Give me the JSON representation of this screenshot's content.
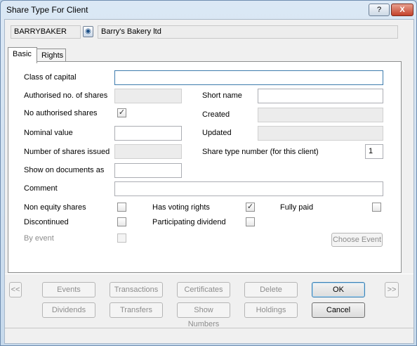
{
  "window": {
    "title": "Share Type For Client",
    "help_label": "?",
    "close_label": "X"
  },
  "header": {
    "client_code": "BARRYBAKER",
    "client_name": "Barry's Bakery ltd"
  },
  "tabs": [
    {
      "label": "Basic"
    },
    {
      "label": "Rights"
    }
  ],
  "form": {
    "class_of_capital_label": "Class of capital",
    "class_of_capital_value": "",
    "authorised_label": "Authorised no. of shares",
    "short_name_label": "Short name",
    "short_name_value": "",
    "no_authorised_label": "No authorised shares",
    "no_authorised_checked": true,
    "created_label": "Created",
    "nominal_label": "Nominal value",
    "nominal_value": "",
    "updated_label": "Updated",
    "issued_label": "Number of shares issued",
    "share_type_number_label": "Share type number (for this client)",
    "share_type_number_value": "1",
    "show_on_docs_label": "Show on documents as",
    "show_on_docs_value": "",
    "comment_label": "Comment",
    "comment_value": "",
    "non_equity_label": "Non equity shares",
    "voting_label": "Has voting rights",
    "voting_checked": true,
    "fully_paid_label": "Fully paid",
    "discontinued_label": "Discontinued",
    "participating_label": "Participating dividend",
    "by_event_label": "By event",
    "choose_event_label": "Choose Event"
  },
  "buttons": {
    "prev": "<<",
    "next": ">>",
    "events": "Events",
    "transactions": "Transactions",
    "certificates": "Certificates",
    "delete": "Delete",
    "ok": "OK",
    "dividends": "Dividends",
    "transfers": "Transfers",
    "show_numbers": "Show Numbers",
    "holdings": "Holdings",
    "cancel": "Cancel"
  },
  "check_mark": "✓"
}
